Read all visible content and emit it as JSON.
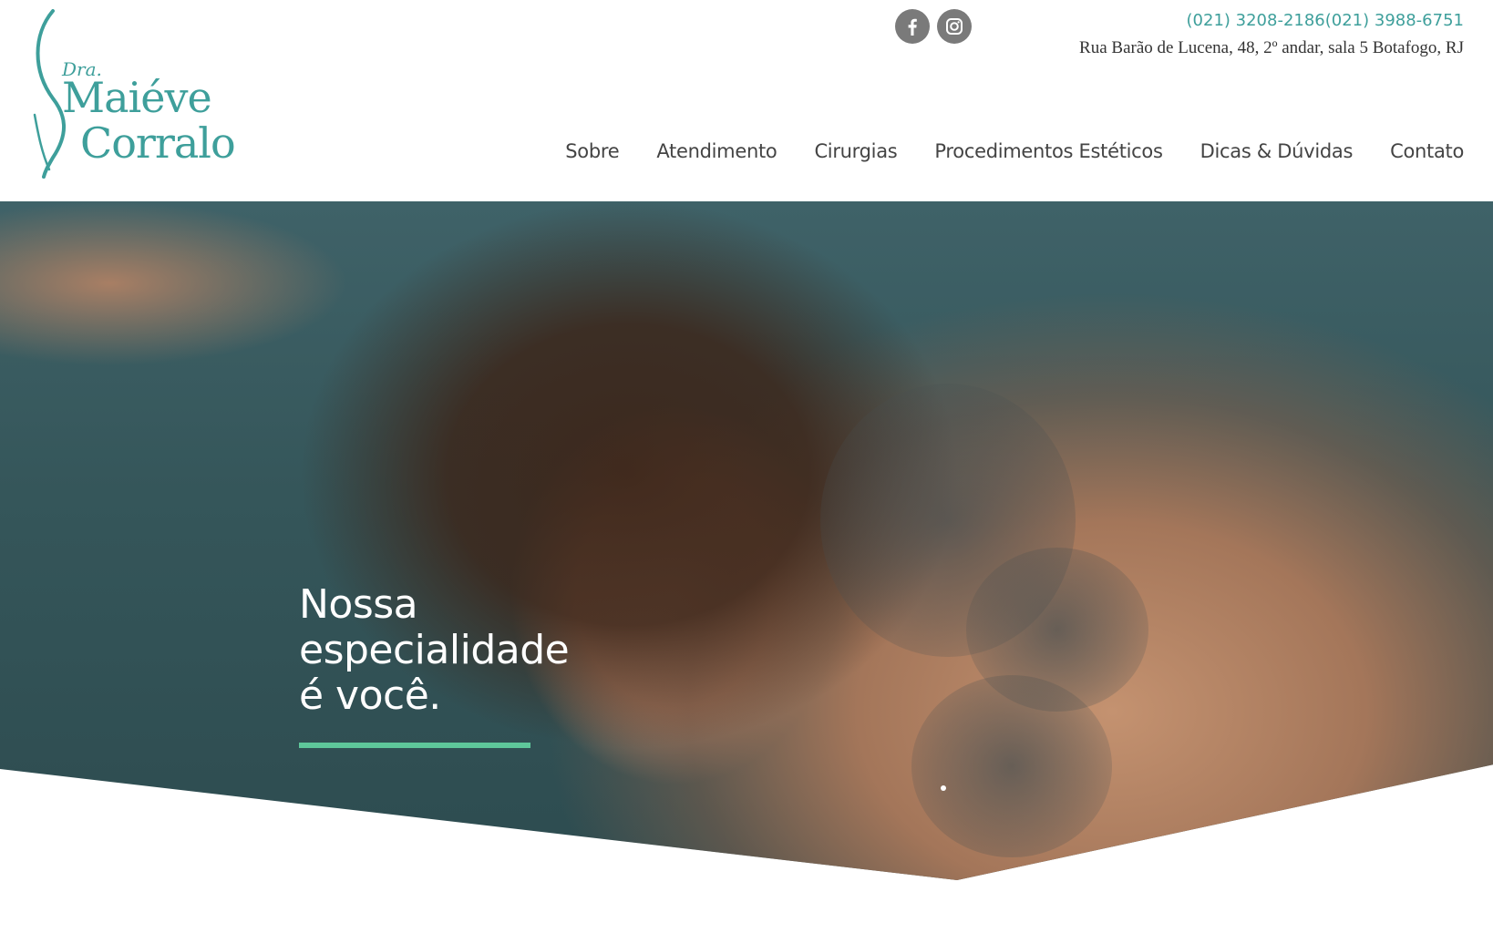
{
  "brand": {
    "prefix": "Dra.",
    "first_name": "Maiéve",
    "last_name": "Corralo"
  },
  "contact": {
    "phones": "(021) 3208-2186(021) 3988-6751",
    "address": "Rua Barão de Lucena, 48, 2º andar, sala 5 Botafogo, RJ"
  },
  "social": {
    "facebook_icon": "facebook-icon",
    "instagram_icon": "instagram-icon"
  },
  "nav": {
    "items": [
      {
        "label": "Sobre"
      },
      {
        "label": "Atendimento"
      },
      {
        "label": "Cirurgias"
      },
      {
        "label": "Procedimentos Estéticos"
      },
      {
        "label": "Dicas & Dúvidas"
      },
      {
        "label": "Contato"
      }
    ]
  },
  "hero": {
    "headline_line1": "Nossa",
    "headline_line2": "especialidade",
    "headline_line3": "é você."
  },
  "colors": {
    "brand_teal": "#3e9f9b",
    "accent_green": "#5ec79a",
    "nav_text": "#444444",
    "icon_gray": "#7a7a7a"
  }
}
